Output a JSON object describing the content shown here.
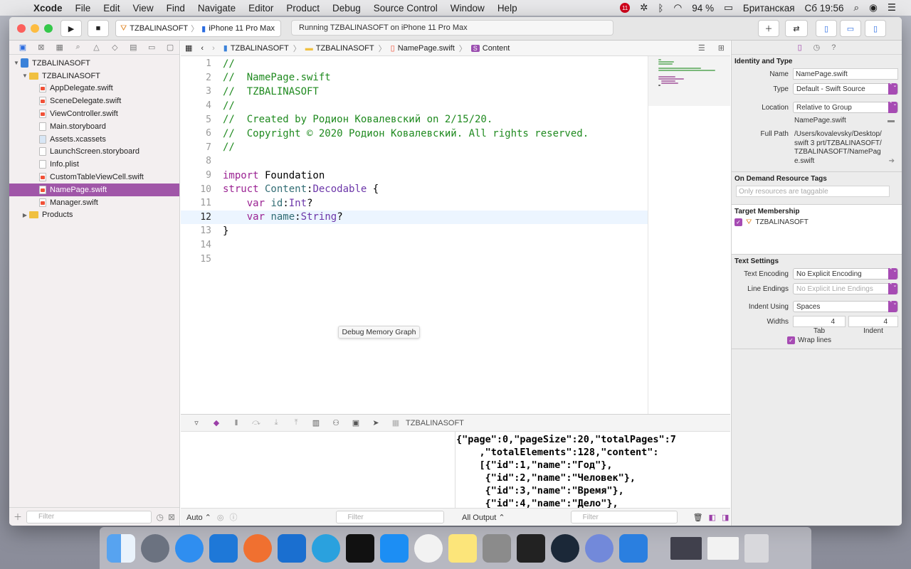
{
  "menubar": {
    "app": "Xcode",
    "items": [
      "File",
      "Edit",
      "View",
      "Find",
      "Navigate",
      "Editor",
      "Product",
      "Debug",
      "Source Control",
      "Window",
      "Help"
    ],
    "status": {
      "notif_badge": "11",
      "battery": "94 %",
      "keyboard": "Британская",
      "clock": "Сб 19:56"
    }
  },
  "toolbar": {
    "scheme": "TZBALINASOFT",
    "device": "iPhone 11 Pro Max",
    "activity": "Running TZBALINASOFT on iPhone 11 Pro Max"
  },
  "navigator": {
    "root": "TZBALINASOFT",
    "group": "TZBALINASOFT",
    "files": [
      "AppDelegate.swift",
      "SceneDelegate.swift",
      "ViewController.swift",
      "Main.storyboard",
      "Assets.xcassets",
      "LaunchScreen.storyboard",
      "Info.plist",
      "CustomTableViewCell.swift",
      "NamePage.swift",
      "Manager.swift"
    ],
    "products": "Products",
    "filter_placeholder": "Filter"
  },
  "jumpbar": {
    "crumbs": [
      "TZBALINASOFT",
      "TZBALINASOFT",
      "NamePage.swift",
      "Content"
    ]
  },
  "editor": {
    "line_numbers": [
      "1",
      "2",
      "3",
      "4",
      "5",
      "6",
      "7",
      "8",
      "9",
      "10",
      "11",
      "12",
      "13",
      "14",
      "15"
    ],
    "current_line": "12",
    "lines": {
      "l1": "//",
      "l2": "//  NamePage.swift",
      "l3": "//  TZBALINASOFT",
      "l4": "//",
      "l5": "//  Created by Родион Ковалевский on 2/15/20.",
      "l6": "//  Copyright © 2020 Родион Ковалевский. All rights reserved.",
      "l7": "//",
      "l9_kw": "import",
      "l9_rest": " Foundation",
      "l10_kw": "struct",
      "l10_name": " Content",
      "l10_colon": ":",
      "l10_proto": "Decodable",
      "l10_brace": " {",
      "l11_kw": "var",
      "l11_name": " id",
      "l11_colon": ":",
      "l11_type": "Int",
      "l11_q": "?",
      "l12_kw": "var",
      "l12_name": " name",
      "l12_colon": ":",
      "l12_type": "String",
      "l12_q": "?",
      "l13": "}"
    }
  },
  "tooltip": "Debug Memory Graph",
  "debug": {
    "target": "TZBALINASOFT",
    "console_lines": [
      "{\"page\":0,\"pageSize\":20,\"totalPages\":7",
      "    ,\"totalElements\":128,\"content\":",
      "    [{\"id\":1,\"name\":\"Год\"},",
      "     {\"id\":2,\"name\":\"Человек\"},",
      "     {\"id\":3,\"name\":\"Время\"},",
      "     {\"id\":4,\"name\":\"Дело\"},"
    ],
    "auto_label": "Auto ⌃",
    "all_output_label": "All Output ⌃",
    "filter_placeholder": "Filter"
  },
  "inspector": {
    "identity": {
      "title": "Identity and Type",
      "name_label": "Name",
      "name_value": "NamePage.swift",
      "type_label": "Type",
      "type_value": "Default - Swift Source",
      "location_label": "Location",
      "location_value": "Relative to Group",
      "location_file": "NamePage.swift",
      "fullpath_label": "Full Path",
      "fullpath_value": "/Users/kovalevsky/Desktop/swift 3 prt/TZBALINASOFT/TZBALINASOFT/NamePage.swift"
    },
    "ondemand": {
      "title": "On Demand Resource Tags",
      "placeholder": "Only resources are taggable"
    },
    "target": {
      "title": "Target Membership",
      "target_name": "TZBALINASOFT"
    },
    "text_settings": {
      "title": "Text Settings",
      "encoding_label": "Text Encoding",
      "encoding_value": "No Explicit Encoding",
      "endings_label": "Line Endings",
      "endings_value": "No Explicit Line Endings",
      "indent_label": "Indent Using",
      "indent_value": "Spaces",
      "widths_label": "Widths",
      "tab_value": "4",
      "indent_width_value": "4",
      "tab_caption": "Tab",
      "indent_caption": "Indent",
      "wrap_label": "Wrap lines"
    }
  },
  "colors": {
    "selection": "#a056a8",
    "comment": "#1f8a1f",
    "keyword": "#9b2393"
  }
}
